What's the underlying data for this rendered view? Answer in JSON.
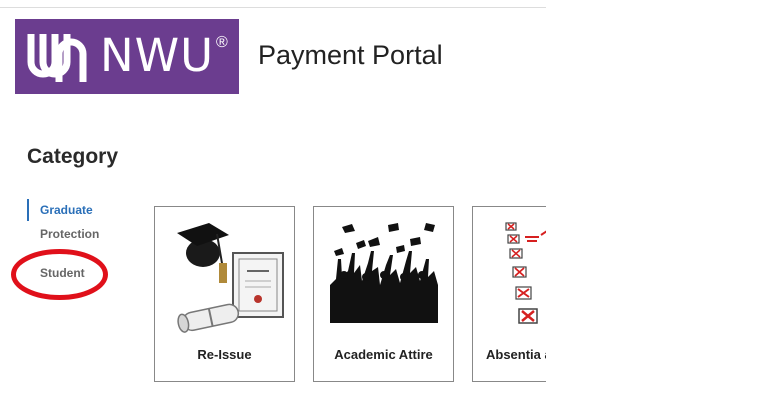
{
  "header": {
    "logo_text": "NWU",
    "logo_registered": "®",
    "portal_title": "Payment Portal"
  },
  "category": {
    "heading": "Category",
    "items": [
      {
        "label": "Graduate",
        "active": true
      },
      {
        "label": "Protection",
        "active": false
      },
      {
        "label": "Student",
        "active": false
      }
    ]
  },
  "cards": [
    {
      "label": "Re-Issue",
      "icon": "graduation-cap-diploma-icon"
    },
    {
      "label": "Academic Attire",
      "icon": "celebrating-crowd-icon"
    },
    {
      "label": "Absentia a",
      "icon": "checklist-icon"
    }
  ],
  "colors": {
    "brand_purple": "#6b3d8f",
    "active_blue": "#2a6fb8",
    "annotation_red": "#e0101a"
  }
}
